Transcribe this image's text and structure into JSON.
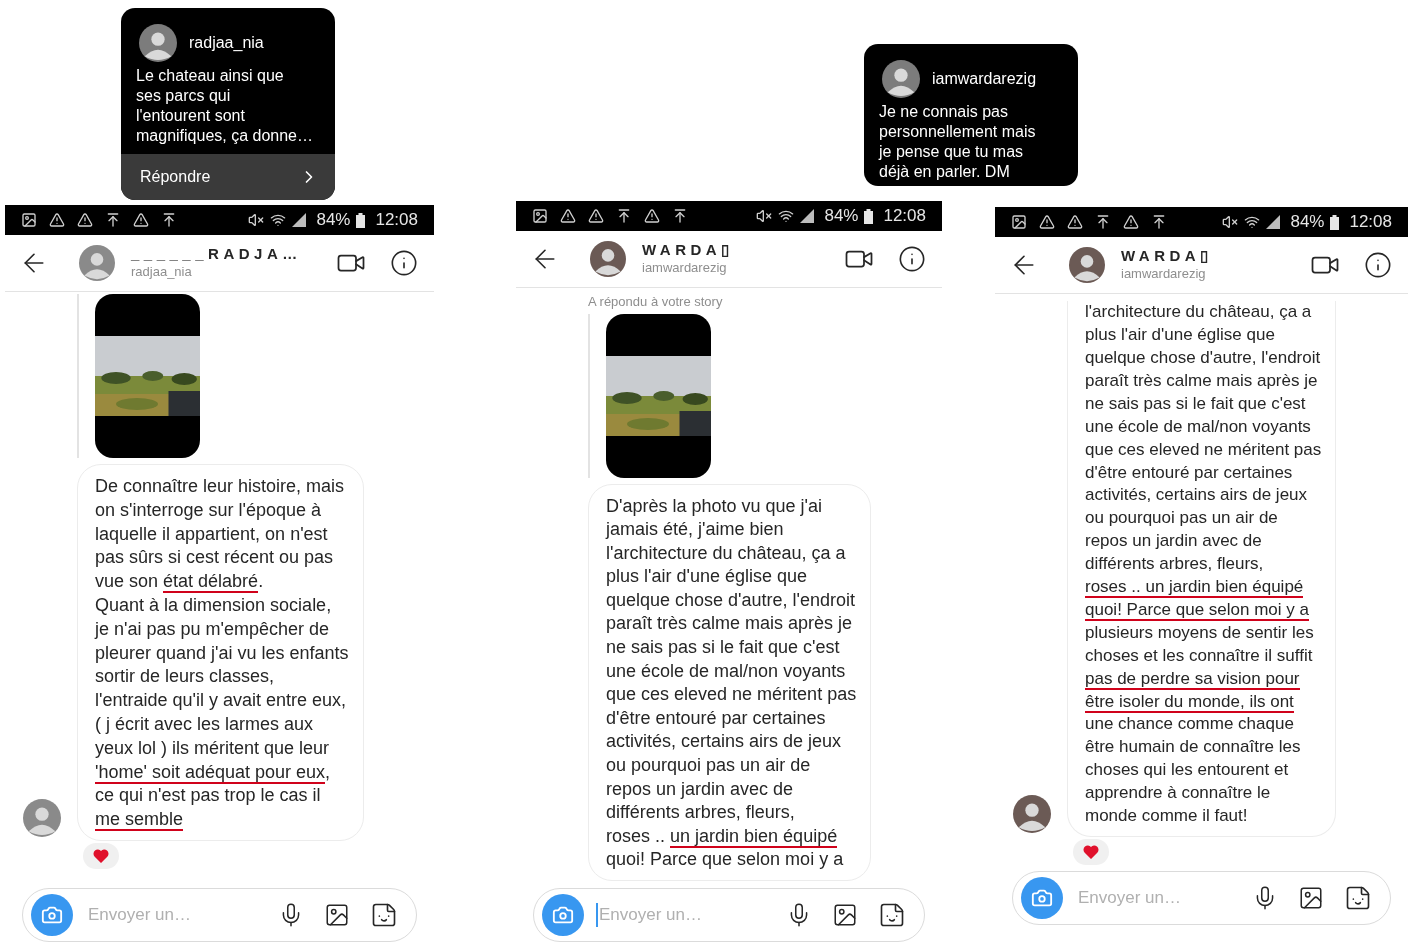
{
  "notifications": [
    {
      "username": "radjaa_nia",
      "lines": [
        "Le chateau ainsi que",
        "ses parcs qui",
        "l'entourent sont",
        "magnifiques, ça donne…"
      ],
      "action": "Répondre"
    },
    {
      "username": "iamwardarezig",
      "lines": [
        "Je ne connais pas",
        "personnellement mais",
        "je pense que tu mas",
        "déjà en parler. DM"
      ]
    }
  ],
  "phones": [
    {
      "status_bar": {
        "battery": "84%",
        "time": "12:08"
      },
      "header": {
        "name": "______RADJA…",
        "username": "radjaa_nia"
      },
      "story_preview": true,
      "message": {
        "continued": false,
        "avatar": true,
        "lines": [
          [
            {
              "t": "De connaître leur histoire, mais",
              "underlined": false
            }
          ],
          [
            {
              "t": "on s'interroge sur l'époque à",
              "underlined": false
            }
          ],
          [
            {
              "t": "laquelle il appartient, on n'est",
              "underlined": false
            }
          ],
          [
            {
              "t": "pas sûrs si cest récent ou pas",
              "underlined": false
            }
          ],
          [
            {
              "t": "vue son ",
              "underlined": false
            },
            {
              "t": "état délabré",
              "underlined": true
            },
            {
              "t": ".",
              "underlined": false
            }
          ],
          [
            {
              "t": "Quant à la dimension sociale,",
              "underlined": false
            }
          ],
          [
            {
              "t": "je n'ai pas pu m'empêcher de",
              "underlined": false
            }
          ],
          [
            {
              "t": "pleurer quand j'ai vu les enfants",
              "underlined": false
            }
          ],
          [
            {
              "t": "sortir de leurs classes,",
              "underlined": false
            }
          ],
          [
            {
              "t": "l'entraide qu'il y avait entre eux,",
              "underlined": false
            }
          ],
          [
            {
              "t": "( j écrit avec les larmes aux",
              "underlined": false
            }
          ],
          [
            {
              "t": "yeux lol ) ils méritent que leur",
              "underlined": false
            }
          ],
          [
            {
              "t": "'home' soit adéquat pour eux",
              "underlined": true
            },
            {
              "t": ",",
              "underlined": false
            }
          ],
          [
            {
              "t": "ce qui n'est pas trop le cas il",
              "underlined": false
            }
          ],
          [
            {
              "t": "me semble",
              "underlined": true
            }
          ]
        ]
      },
      "reacted": true,
      "composer": {
        "placeholder": "Envoyer un…",
        "focused": false
      }
    },
    {
      "status_bar": {
        "battery": "84%",
        "time": "12:08"
      },
      "header": {
        "name": "WARDA▯",
        "username": "iamwardarezig"
      },
      "story_note": "A répondu à votre story",
      "story_preview": true,
      "message": {
        "continued": false,
        "avatar": false,
        "lines": [
          [
            {
              "t": "D'après la photo vu que j'ai",
              "underlined": false
            }
          ],
          [
            {
              "t": "jamais été, j'aime bien",
              "underlined": false
            }
          ],
          [
            {
              "t": "l'architecture du château, ça a",
              "underlined": false
            }
          ],
          [
            {
              "t": "plus l'air d'une église que",
              "underlined": false
            }
          ],
          [
            {
              "t": "quelque chose d'autre, l'endroit",
              "underlined": false
            }
          ],
          [
            {
              "t": "paraît très calme mais après je",
              "underlined": false
            }
          ],
          [
            {
              "t": "ne sais pas si le fait que c'est",
              "underlined": false
            }
          ],
          [
            {
              "t": "une école de mal/non voyants",
              "underlined": false
            }
          ],
          [
            {
              "t": "que ces eleved ne méritent pas",
              "underlined": false
            }
          ],
          [
            {
              "t": "d'être entouré par certaines",
              "underlined": false
            }
          ],
          [
            {
              "t": "activités, certains airs de jeux",
              "underlined": false
            }
          ],
          [
            {
              "t": "ou pourquoi pas un air de",
              "underlined": false
            }
          ],
          [
            {
              "t": "repos un jardin avec de",
              "underlined": false
            }
          ],
          [
            {
              "t": "différents arbres, fleurs,",
              "underlined": false
            }
          ],
          [
            {
              "t": "roses .. ",
              "underlined": false
            },
            {
              "t": "un jardin bien équipé",
              "underlined": true
            }
          ],
          [
            {
              "t": "quoi! Parce que selon moi y a",
              "underlined": false
            }
          ]
        ]
      },
      "composer": {
        "placeholder": "Envoyer un…",
        "focused": true
      }
    },
    {
      "status_bar": {
        "battery": "84%",
        "time": "12:08"
      },
      "header": {
        "name": "WARDA▯",
        "username": "iamwardarezig"
      },
      "story_preview": false,
      "message": {
        "continued": true,
        "avatar": true,
        "lines": [
          [
            {
              "t": "l'architecture du château, ça a",
              "underlined": false
            }
          ],
          [
            {
              "t": "plus l'air d'une église que",
              "underlined": false
            }
          ],
          [
            {
              "t": "quelque chose d'autre, l'endroit",
              "underlined": false
            }
          ],
          [
            {
              "t": "paraît très calme mais après je",
              "underlined": false
            }
          ],
          [
            {
              "t": "ne sais pas si le fait que c'est",
              "underlined": false
            }
          ],
          [
            {
              "t": "une école de mal/non voyants",
              "underlined": false
            }
          ],
          [
            {
              "t": "que ces eleved ne méritent pas",
              "underlined": false
            }
          ],
          [
            {
              "t": "d'être entouré par certaines",
              "underlined": false
            }
          ],
          [
            {
              "t": "activités, certains airs de jeux",
              "underlined": false
            }
          ],
          [
            {
              "t": "ou pourquoi pas un air de",
              "underlined": false
            }
          ],
          [
            {
              "t": "repos un jardin avec de",
              "underlined": false
            }
          ],
          [
            {
              "t": "différents arbres, fleurs,",
              "underlined": false
            }
          ],
          [
            {
              "t": "roses .. un jardin bien équipé",
              "underlined": true
            }
          ],
          [
            {
              "t": "quoi! Parce que selon moi y a",
              "underlined": true
            }
          ],
          [
            {
              "t": "plusieurs moyens de sentir les",
              "underlined": false
            }
          ],
          [
            {
              "t": "choses et les connaître il suffit",
              "underlined": false
            }
          ],
          [
            {
              "t": "pas de perdre sa vision pour",
              "underlined": true
            }
          ],
          [
            {
              "t": "être isoler du monde, ils ont",
              "underlined": true
            }
          ],
          [
            {
              "t": "une chance comme chaque",
              "underlined": false
            }
          ],
          [
            {
              "t": "être humain de connaître les",
              "underlined": false
            }
          ],
          [
            {
              "t": "choses qui les entourent et",
              "underlined": false
            }
          ],
          [
            {
              "t": "apprendre à connaître le",
              "underlined": false
            }
          ],
          [
            {
              "t": "monde comme il faut!",
              "underlined": false
            }
          ]
        ]
      },
      "reacted": true,
      "composer": {
        "placeholder": "Envoyer un…",
        "focused": false
      }
    }
  ]
}
